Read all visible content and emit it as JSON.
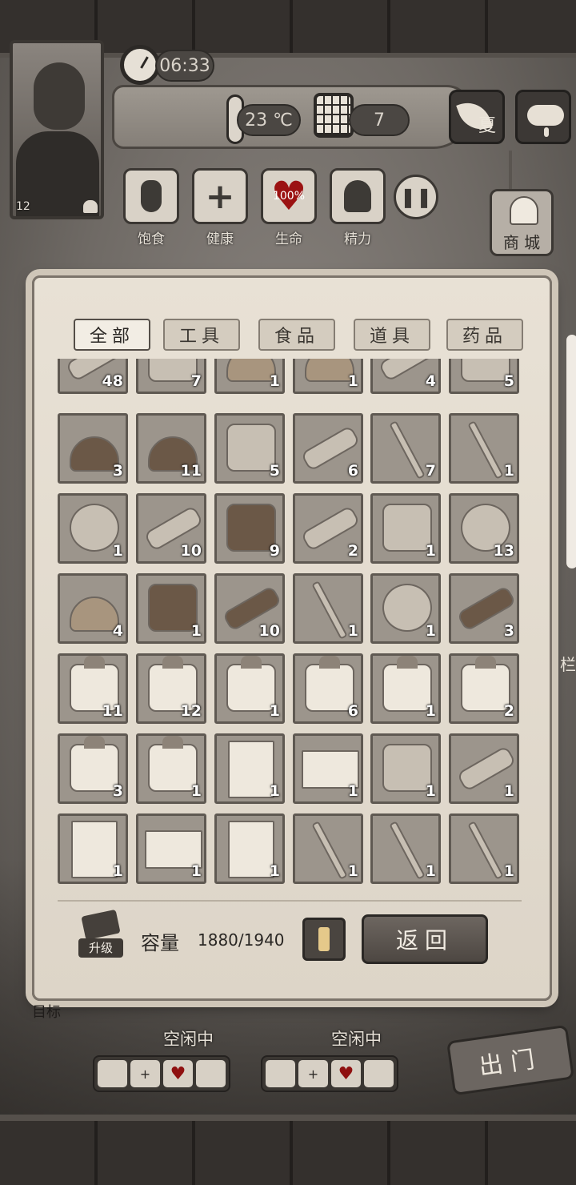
{
  "hud": {
    "time": "06:33",
    "temperature": "23 ℃",
    "day": "7",
    "season": "夏",
    "level": "12",
    "weather_icon": "rain-cloud-icon"
  },
  "vitals": [
    {
      "label": "饱食",
      "icon": "stomach-icon"
    },
    {
      "label": "健康",
      "icon": "cross-icon"
    },
    {
      "label": "生命",
      "icon": "heart-icon",
      "value": "100%"
    },
    {
      "label": "精力",
      "icon": "person-icon"
    }
  ],
  "shop": {
    "label": "商 城"
  },
  "tabs": [
    {
      "label": "全部",
      "active": true
    },
    {
      "label": "工具",
      "active": false
    },
    {
      "label": "食品",
      "active": false
    },
    {
      "label": "道具",
      "active": false
    },
    {
      "label": "药品",
      "active": false
    }
  ],
  "inventory": {
    "rows": [
      [
        {
          "item": "sticks",
          "count": "48"
        },
        {
          "item": "tool-box",
          "count": "7"
        },
        {
          "item": "ore-pile",
          "count": "1"
        },
        {
          "item": "ore-pile",
          "count": "1"
        },
        {
          "item": "worms",
          "count": "4"
        },
        {
          "item": "animal-hide",
          "count": "5"
        }
      ],
      [
        {
          "item": "mud",
          "count": "3"
        },
        {
          "item": "rocks",
          "count": "11"
        },
        {
          "item": "alcohol-bottle",
          "count": "5"
        },
        {
          "item": "fish-fillets",
          "count": "6"
        },
        {
          "item": "needles",
          "count": "7"
        },
        {
          "item": "horns",
          "count": "1"
        }
      ],
      [
        {
          "item": "pearl-shell",
          "count": "1"
        },
        {
          "item": "feather",
          "count": "10"
        },
        {
          "item": "sponge",
          "count": "9"
        },
        {
          "item": "horn",
          "count": "2"
        },
        {
          "item": "fish",
          "count": "1"
        },
        {
          "item": "shrimp",
          "count": "13"
        }
      ],
      [
        {
          "item": "salt",
          "count": "4"
        },
        {
          "item": "backpack",
          "count": "1"
        },
        {
          "item": "bottle",
          "count": "10"
        },
        {
          "item": "dagger",
          "count": "1"
        },
        {
          "item": "necklace",
          "count": "1"
        },
        {
          "item": "wood-plank",
          "count": "3"
        }
      ],
      [
        {
          "item": "gift-box",
          "count": "11"
        },
        {
          "item": "gift-box-medical",
          "count": "12"
        },
        {
          "item": "gift-box-tools",
          "count": "1"
        },
        {
          "item": "gift-box-tools",
          "count": "6"
        },
        {
          "item": "gift-box-wood",
          "count": "1"
        },
        {
          "item": "gift-box-food",
          "count": "2"
        }
      ],
      [
        {
          "item": "gift-box-medical",
          "count": "3"
        },
        {
          "item": "gift-box-tools",
          "count": "1"
        },
        {
          "item": "note",
          "count": "1"
        },
        {
          "item": "envelope",
          "count": "1"
        },
        {
          "item": "book",
          "count": "1"
        },
        {
          "item": "scroll",
          "count": "1"
        }
      ],
      [
        {
          "item": "note",
          "count": "1"
        },
        {
          "item": "envelope",
          "count": "1"
        },
        {
          "item": "note",
          "count": "1"
        },
        {
          "item": "pipe",
          "count": "1"
        },
        {
          "item": "pipe",
          "count": "1"
        },
        {
          "item": "pipe",
          "count": "1"
        }
      ]
    ]
  },
  "footer": {
    "upgrade_label": "升级",
    "capacity_label": "容量",
    "capacity_value": "1880/1940",
    "back_label": "返回"
  },
  "bottom": {
    "objective": "目标",
    "survivors": [
      {
        "status": "空闲中"
      },
      {
        "status": "空闲中"
      }
    ],
    "go_out_label": "出门",
    "side_label": "栏"
  }
}
